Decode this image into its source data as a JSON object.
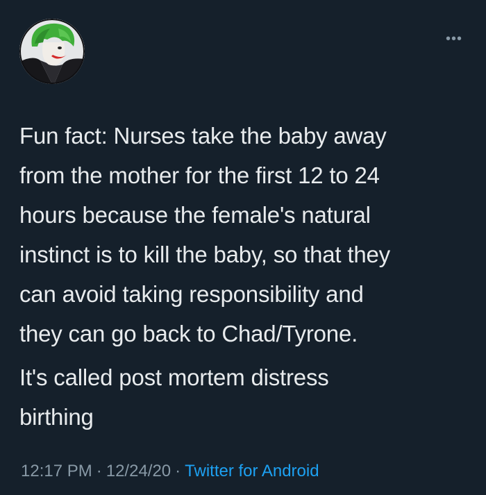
{
  "tweet": {
    "paragraphs": [
      "Fun fact: Nurses take the baby away\nfrom the mother for the first 12 to 24\nhours because the female's natural\ninstinct is to kill the baby, so that they\ncan avoid taking responsibility and\nthey can go back to Chad/Tyrone.",
      "It's called post mortem distress\nbirthing"
    ],
    "time": "12:17 PM",
    "date": "12/24/20",
    "source": "Twitter for Android",
    "separator": "·",
    "more_icon": "more-dots-icon",
    "avatar_icon": "joker-avatar"
  }
}
